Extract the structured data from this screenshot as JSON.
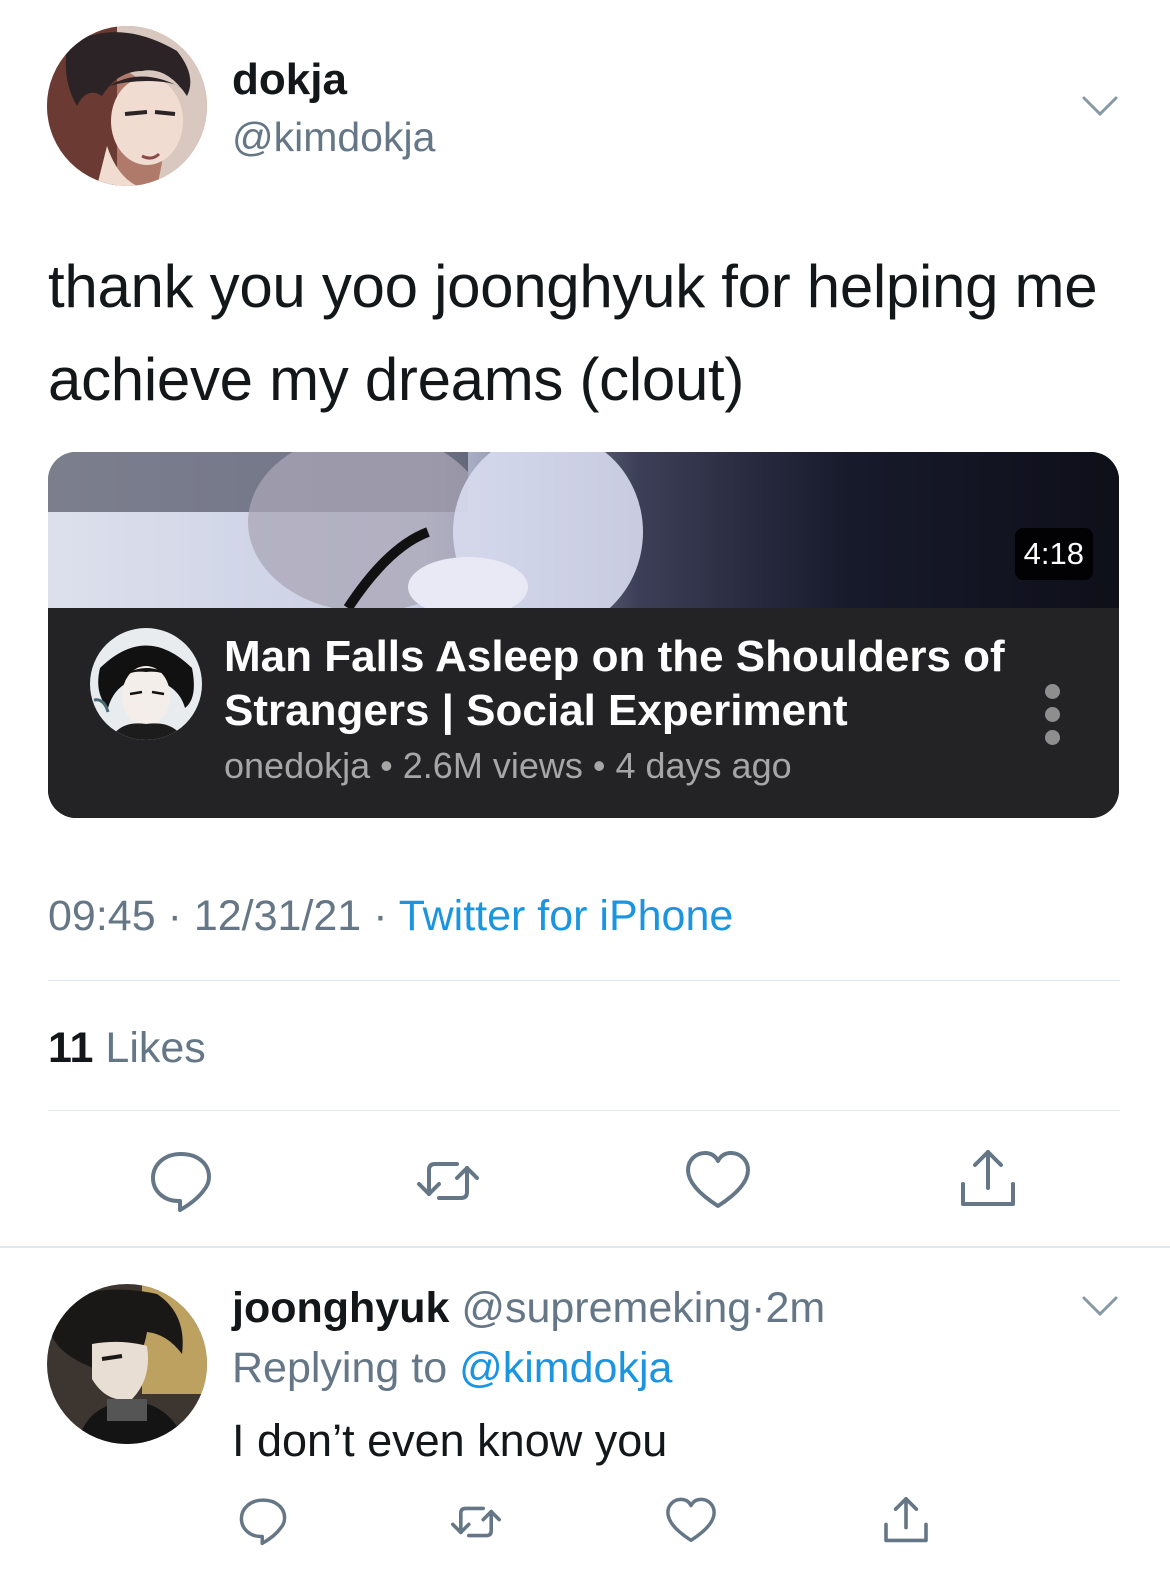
{
  "tweet": {
    "author_name": "dokja",
    "author_handle": "@kimdokja",
    "text": "thank you yoo joonghyuk for helping me achieve my dreams (clout)",
    "time": "09:45",
    "date": "12/31/21",
    "separator": "·",
    "source": "Twitter for iPhone",
    "likes_count": "11",
    "likes_label": "Likes"
  },
  "video_card": {
    "duration": "4:18",
    "title": "Man Falls Asleep on the Shoulders of Strangers | Social Experiment",
    "channel": "onedokja",
    "views": "2.6M views",
    "age": "4 days ago",
    "meta_separator": "•"
  },
  "reply": {
    "author_name": "joonghyuk",
    "author_handle": "@supremeking",
    "age": "2m",
    "replying_label": "Replying to",
    "replying_to": "@kimdokja",
    "text": "I don’t even know you"
  },
  "icons": {
    "reply": "comment-bubble-icon",
    "retweet": "retweet-arrows-icon",
    "like": "heart-icon",
    "share": "share-upload-icon",
    "menu": "chevron-down-icon",
    "video_menu": "vertical-ellipsis-icon"
  },
  "colors": {
    "link": "#1b95e0",
    "secondary": "#657786",
    "icon": "#657786",
    "card_bg": "#232325"
  }
}
